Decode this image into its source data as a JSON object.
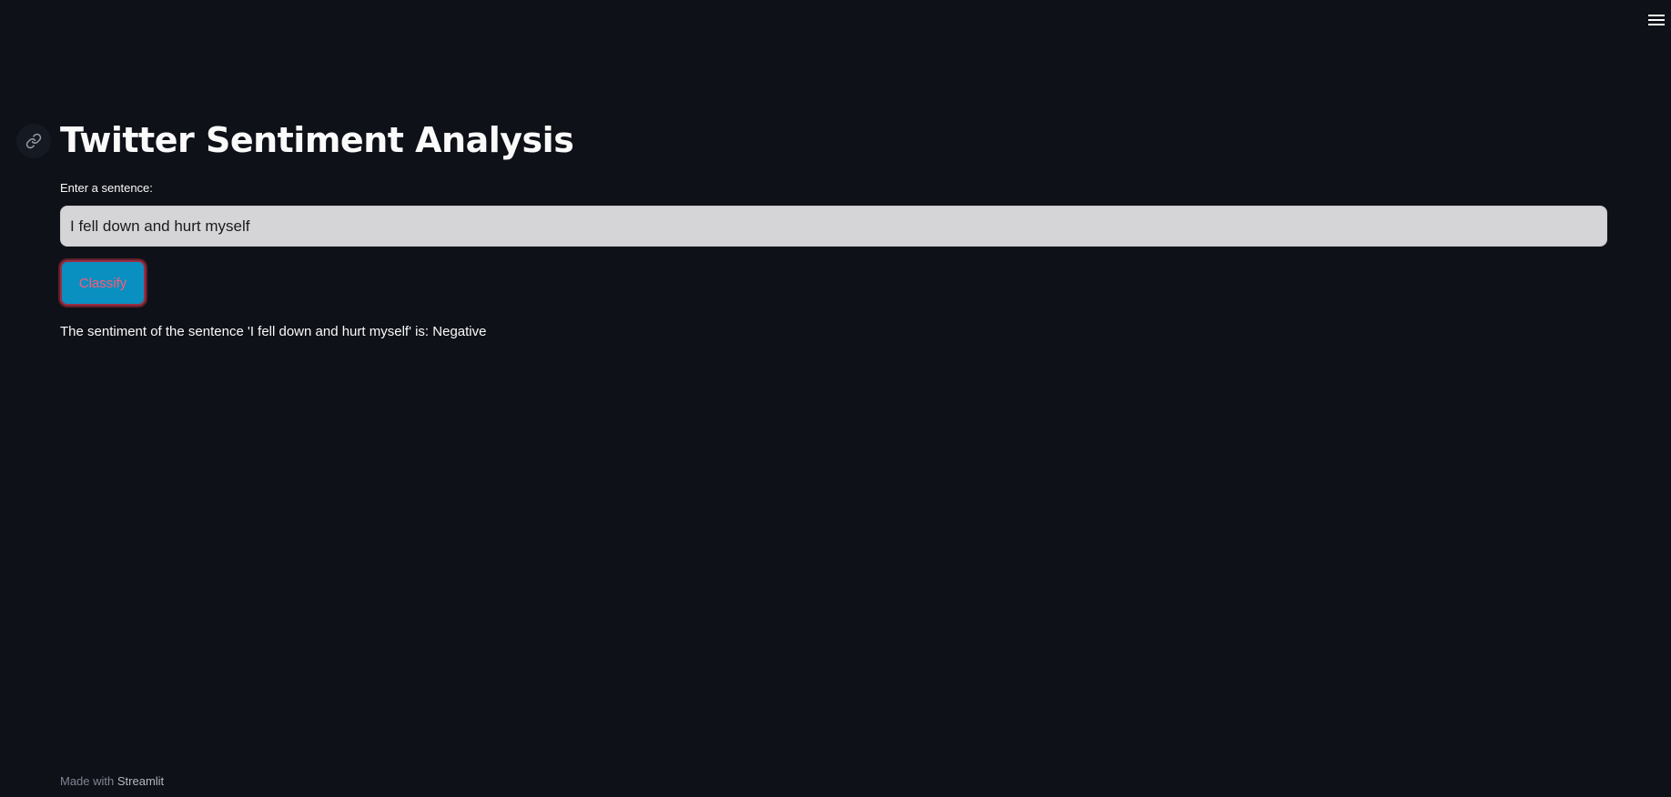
{
  "header": {
    "menu_icon": "hamburger-menu-icon"
  },
  "main": {
    "title": "Twitter Sentiment Analysis",
    "anchor_icon": "link-icon",
    "input_label": "Enter a sentence:",
    "input_value": "I fell down and hurt myself",
    "button_label": "Classify",
    "result": "The sentiment of the sentence 'I fell down and hurt myself' is: Negative"
  },
  "footer": {
    "prefix": "Made with",
    "brand": "Streamlit"
  },
  "colors": {
    "background": "#0e1117",
    "button_bg": "#0a8fc1",
    "button_text": "#ff5a74",
    "input_bg": "#d5d5d8"
  }
}
